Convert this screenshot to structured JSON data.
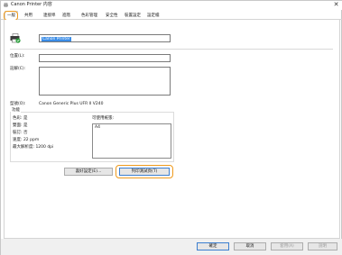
{
  "window": {
    "title": "Canon Printer 内容",
    "close_glyph": "✕"
  },
  "tabs": [
    {
      "label": "一般",
      "active": true
    },
    {
      "label": "共用"
    },
    {
      "label": "連接埠"
    },
    {
      "label": "進階"
    },
    {
      "label": "色彩管理"
    },
    {
      "label": "安全性"
    },
    {
      "label": "裝置設定"
    },
    {
      "label": "設定檔"
    }
  ],
  "general": {
    "printer_name": "Canon Printer",
    "location_label": "位置(L):",
    "location_value": "",
    "comment_label": "註解(C):",
    "comment_value": "",
    "model_label": "型號(O):",
    "model_value": "Canon Generic Plus UFR II V240"
  },
  "features": {
    "group_title": "功能",
    "color": "色彩: 是",
    "duplex": "雙面: 是",
    "staple": "裝訂: 否",
    "speed": "速度: 22 ppm",
    "max_resolution": "最大解析度: 1200 dpi",
    "paper_label": "可使用紙張:",
    "paper_items": [
      "A4"
    ]
  },
  "buttons": {
    "preferences": "喜好設定(E)...",
    "print_test": "列印測試頁(T)",
    "ok": "確定",
    "cancel": "取消",
    "apply": "套用(A)",
    "help": "說明"
  },
  "icons": {
    "app": "printer-icon",
    "printer": "printer-icon",
    "status": "check-icon"
  },
  "colors": {
    "highlight": "#ef9a1c",
    "selection": "#3a8ce6",
    "status_ok": "#2a9d3a"
  }
}
